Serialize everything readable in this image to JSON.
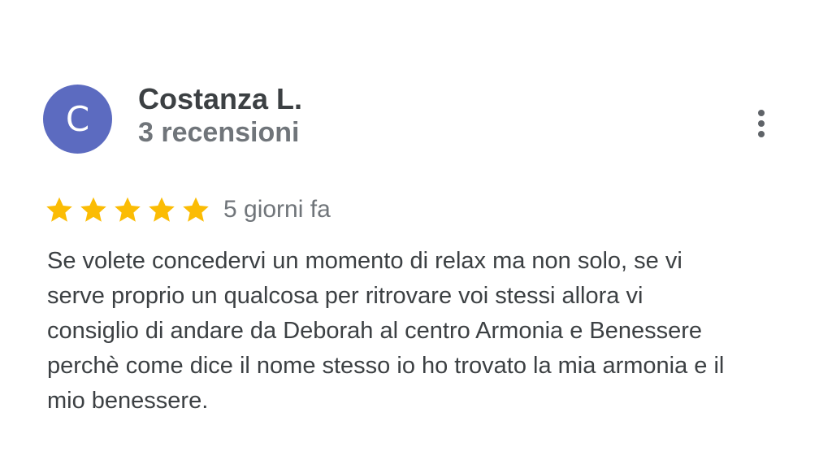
{
  "review": {
    "avatar_initial": "C",
    "avatar_color": "#5c6bc0",
    "author_name": "Costanza L.",
    "author_review_count": "3 recensioni",
    "rating": 5,
    "rating_max": 5,
    "star_color": "#fbbc04",
    "date": "5 giorni fa",
    "text": "Se volete concedervi un momento di relax ma non solo, se vi serve proprio un qualcosa per ritrovare voi stessi allora vi consiglio di andare da Deborah al centro Armonia e Benessere perchè come dice il nome stesso io ho trovato la mia armonia e il mio benessere.",
    "more_icon": "more-vert-icon"
  }
}
